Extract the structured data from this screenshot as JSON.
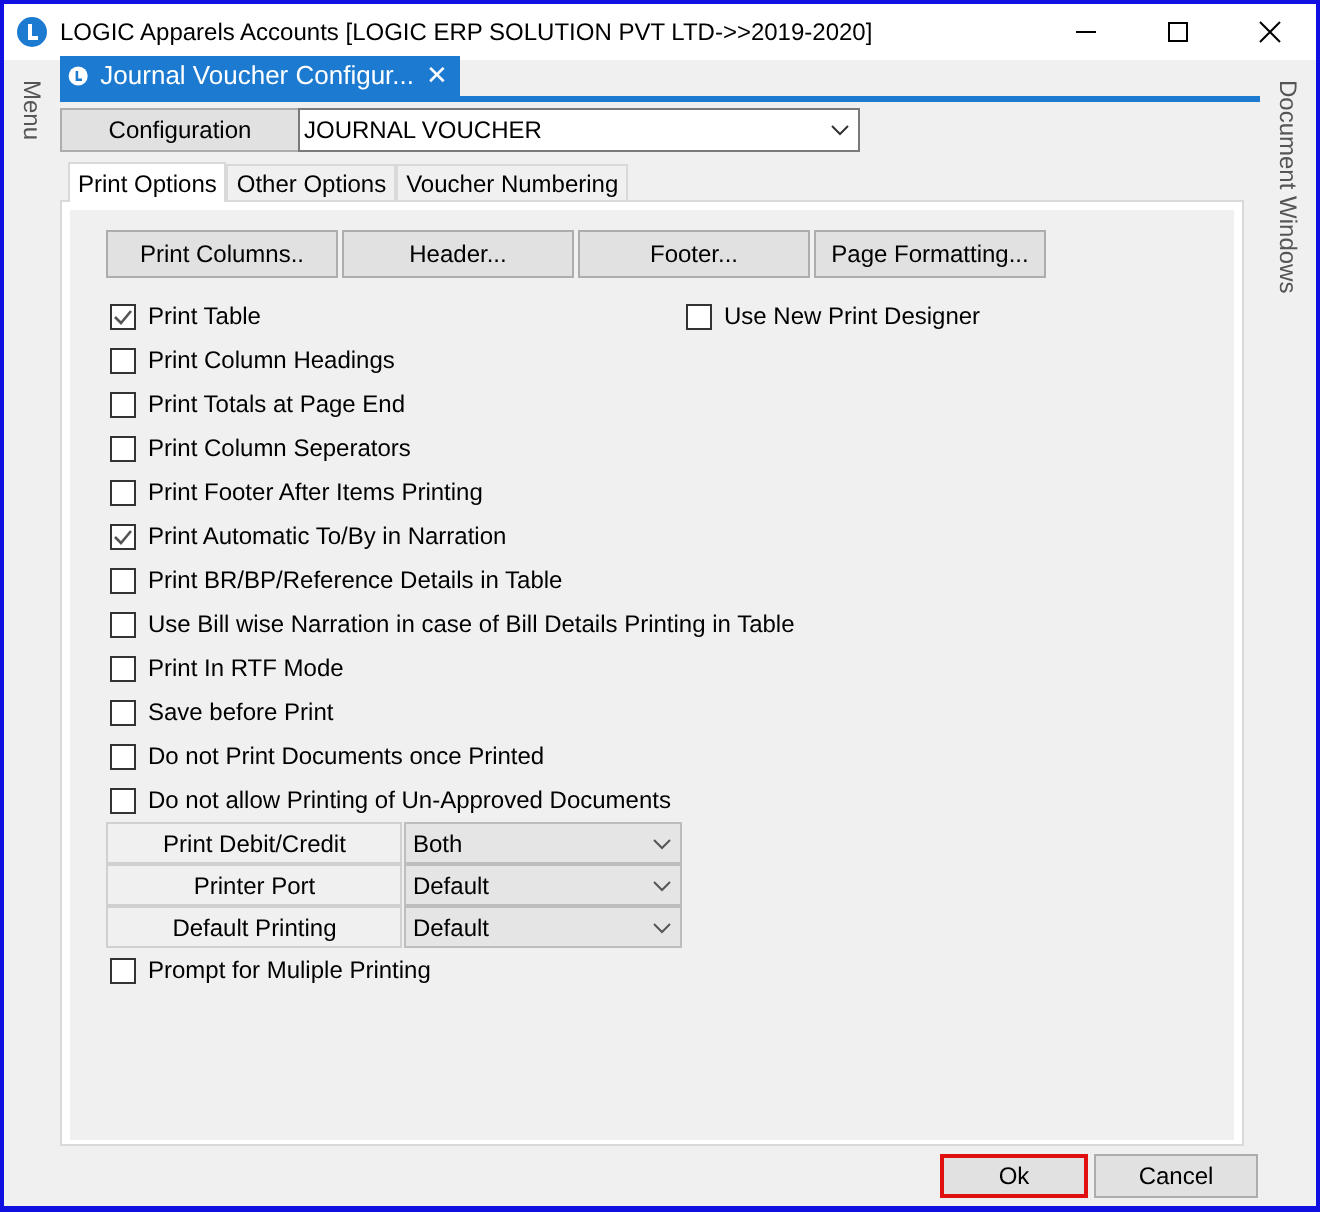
{
  "window": {
    "title": "LOGIC Apparels Accounts  [LOGIC ERP SOLUTION PVT LTD->>2019-2020]"
  },
  "left_sidebar": {
    "label": "Menu"
  },
  "right_sidebar": {
    "label": "Document Windows"
  },
  "document_tab": {
    "title": "Journal Voucher Configur...",
    "close": "✕"
  },
  "configuration": {
    "label": "Configuration",
    "value": "JOURNAL VOUCHER"
  },
  "tabs": [
    {
      "label": "Print Options",
      "selected": true
    },
    {
      "label": "Other Options",
      "selected": false
    },
    {
      "label": "Voucher Numbering",
      "selected": false
    }
  ],
  "buttons": [
    "Print Columns..",
    "Header...",
    "Footer...",
    "Page Formatting..."
  ],
  "side_options": [
    {
      "kind": "checkbox",
      "label": "Use New Print Designer",
      "checked": false
    }
  ],
  "options": [
    {
      "kind": "checkbox",
      "label": "Print Table",
      "checked": true
    },
    {
      "kind": "checkbox",
      "label": "Print Column Headings",
      "checked": false
    },
    {
      "kind": "checkbox",
      "label": "Print Totals at Page End",
      "checked": false
    },
    {
      "kind": "checkbox",
      "label": "Print Column Seperators",
      "checked": false
    },
    {
      "kind": "checkbox",
      "label": "Print Footer After Items Printing",
      "checked": false
    },
    {
      "kind": "checkbox",
      "label": "Print Automatic To/By in Narration",
      "checked": true
    },
    {
      "kind": "checkbox",
      "label": "Print BR/BP/Reference Details in Table",
      "checked": false
    },
    {
      "kind": "checkbox",
      "label": "Use Bill wise Narration in case of Bill Details Printing in Table",
      "checked": false
    },
    {
      "kind": "checkbox",
      "label": "Print In RTF Mode",
      "checked": false
    },
    {
      "kind": "checkbox",
      "label": "Save before Print",
      "checked": false
    },
    {
      "kind": "checkbox",
      "label": "Do not Print Documents once Printed",
      "checked": false
    },
    {
      "kind": "checkbox",
      "label": "Do not allow Printing of Un-Approved Documents",
      "checked": false
    },
    {
      "kind": "select",
      "label": "Print Debit/Credit",
      "value": "Both"
    },
    {
      "kind": "select",
      "label": "Printer Port",
      "value": "Default"
    },
    {
      "kind": "select",
      "label": "Default Printing",
      "value": "Default"
    },
    {
      "kind": "checkbox",
      "label": "Prompt for Muliple Printing",
      "checked": false
    }
  ],
  "footer_buttons": [
    {
      "label": "Ok",
      "focused": true
    },
    {
      "label": "Cancel",
      "focused": false
    }
  ]
}
